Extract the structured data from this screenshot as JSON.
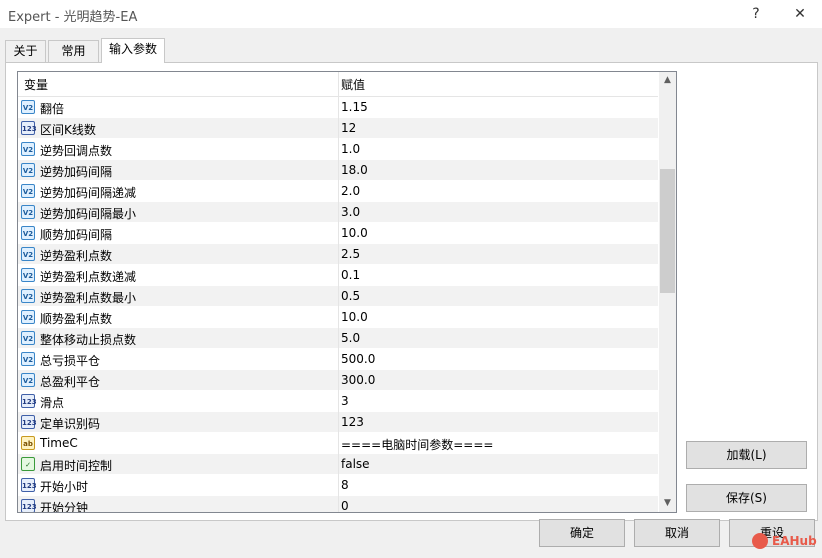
{
  "window": {
    "title": "Expert - 光明趋势-EA",
    "help_glyph": "?",
    "close_glyph": "✕"
  },
  "tabs": [
    {
      "label": "关于",
      "active": false
    },
    {
      "label": "常用",
      "active": false
    },
    {
      "label": "输入参数",
      "active": true
    }
  ],
  "grid": {
    "headers": {
      "variable": "变量",
      "value": "赋值"
    },
    "rows": [
      {
        "icon": "double-icon",
        "icon_text": "V2",
        "name": "翻倍",
        "value": "1.15"
      },
      {
        "icon": "int-icon",
        "icon_text": "123",
        "name": "区间K线数",
        "value": "12"
      },
      {
        "icon": "double-icon",
        "icon_text": "V2",
        "name": "逆势回调点数",
        "value": "1.0"
      },
      {
        "icon": "double-icon",
        "icon_text": "V2",
        "name": "逆势加码间隔",
        "value": "18.0"
      },
      {
        "icon": "double-icon",
        "icon_text": "V2",
        "name": "逆势加码间隔递减",
        "value": "2.0"
      },
      {
        "icon": "double-icon",
        "icon_text": "V2",
        "name": "逆势加码间隔最小",
        "value": "3.0"
      },
      {
        "icon": "double-icon",
        "icon_text": "V2",
        "name": "顺势加码间隔",
        "value": "10.0"
      },
      {
        "icon": "double-icon",
        "icon_text": "V2",
        "name": "逆势盈利点数",
        "value": "2.5"
      },
      {
        "icon": "double-icon",
        "icon_text": "V2",
        "name": "逆势盈利点数递减",
        "value": "0.1"
      },
      {
        "icon": "double-icon",
        "icon_text": "V2",
        "name": "逆势盈利点数最小",
        "value": "0.5"
      },
      {
        "icon": "double-icon",
        "icon_text": "V2",
        "name": "顺势盈利点数",
        "value": "10.0"
      },
      {
        "icon": "double-icon",
        "icon_text": "V2",
        "name": "整体移动止损点数",
        "value": "5.0"
      },
      {
        "icon": "double-icon",
        "icon_text": "V2",
        "name": "总亏损平仓",
        "value": "500.0"
      },
      {
        "icon": "double-icon",
        "icon_text": "V2",
        "name": "总盈利平仓",
        "value": "300.0"
      },
      {
        "icon": "int-icon",
        "icon_text": "123",
        "name": "滑点",
        "value": "3"
      },
      {
        "icon": "int-icon",
        "icon_text": "123",
        "name": "定单识别码",
        "value": "123"
      },
      {
        "icon": "string-icon",
        "icon_text": "ab",
        "name": "TimeC",
        "value": "====电脑时间参数===="
      },
      {
        "icon": "bool-icon",
        "icon_text": "✓",
        "name": "启用时间控制",
        "value": "false"
      },
      {
        "icon": "int-icon",
        "icon_text": "123",
        "name": "开始小时",
        "value": "8"
      },
      {
        "icon": "int-icon",
        "icon_text": "123",
        "name": "开始分钟",
        "value": "0"
      }
    ]
  },
  "buttons": {
    "load": "加载(L)",
    "save": "保存(S)",
    "ok": "确定",
    "cancel": "取消",
    "reset": "重设"
  },
  "watermark": {
    "text": "EAHub"
  }
}
